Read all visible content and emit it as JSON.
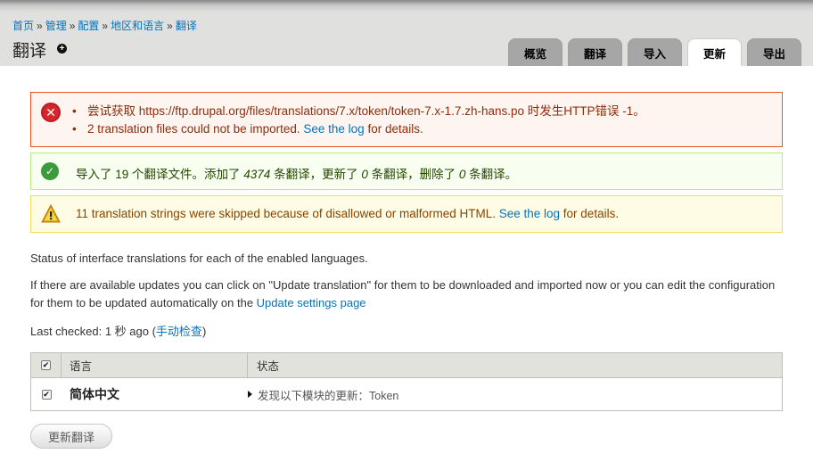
{
  "breadcrumb": [
    {
      "label": "首页"
    },
    {
      "label": "管理"
    },
    {
      "label": "配置"
    },
    {
      "label": "地区和语言"
    },
    {
      "label": "翻译"
    }
  ],
  "breadcrumb_separator": "»",
  "page": {
    "title": "翻译",
    "add_shortcut_symbol": "+"
  },
  "tabs": [
    {
      "label": "概览",
      "active": false
    },
    {
      "label": "翻译",
      "active": false
    },
    {
      "label": "导入",
      "active": false
    },
    {
      "label": "更新",
      "active": true
    },
    {
      "label": "导出",
      "active": false
    }
  ],
  "messages": {
    "error": {
      "item1": "尝试获取 https://ftp.drupal.org/files/translations/7.x/token/token-7.x-1.7.zh-hans.po 时发生HTTP错误 -1。",
      "item2_prefix": "2 translation files could not be imported. ",
      "item2_link": "See the log",
      "item2_suffix": " for details."
    },
    "status": {
      "part1": "导入了 19 个翻译文件。添加了 ",
      "added": "4374",
      "part2": " 条翻译，更新了 ",
      "updated": "0",
      "part3": " 条翻译，删除了 ",
      "deleted": "0",
      "part4": " 条翻译。"
    },
    "warning": {
      "prefix": "11 translation strings were skipped because of disallowed or malformed HTML. ",
      "link": "See the log",
      "suffix": " for details."
    }
  },
  "intro": {
    "status_text": "Status of interface translations for each of the enabled languages.",
    "updates_text_prefix": "If there are available updates you can click on \"Update translation\" for them to be downloaded and imported now or you can edit the configuration for them to be updated automatically on the ",
    "updates_link": "Update settings page",
    "last_checked_prefix": "Last checked: 1 秒 ago (",
    "manual_check_link": "手动检查",
    "last_checked_suffix": ")"
  },
  "table": {
    "headers": {
      "language": "语言",
      "status": "状态"
    },
    "rows": [
      {
        "language": "简体中文",
        "status": "发现以下模块的更新：Token",
        "checked": true
      }
    ]
  },
  "submit_button": "更新翻译",
  "colors": {
    "link": "#0074bd",
    "error_border": "#ed541d",
    "status_border": "#bbee77",
    "warning_border": "#eedd55"
  }
}
